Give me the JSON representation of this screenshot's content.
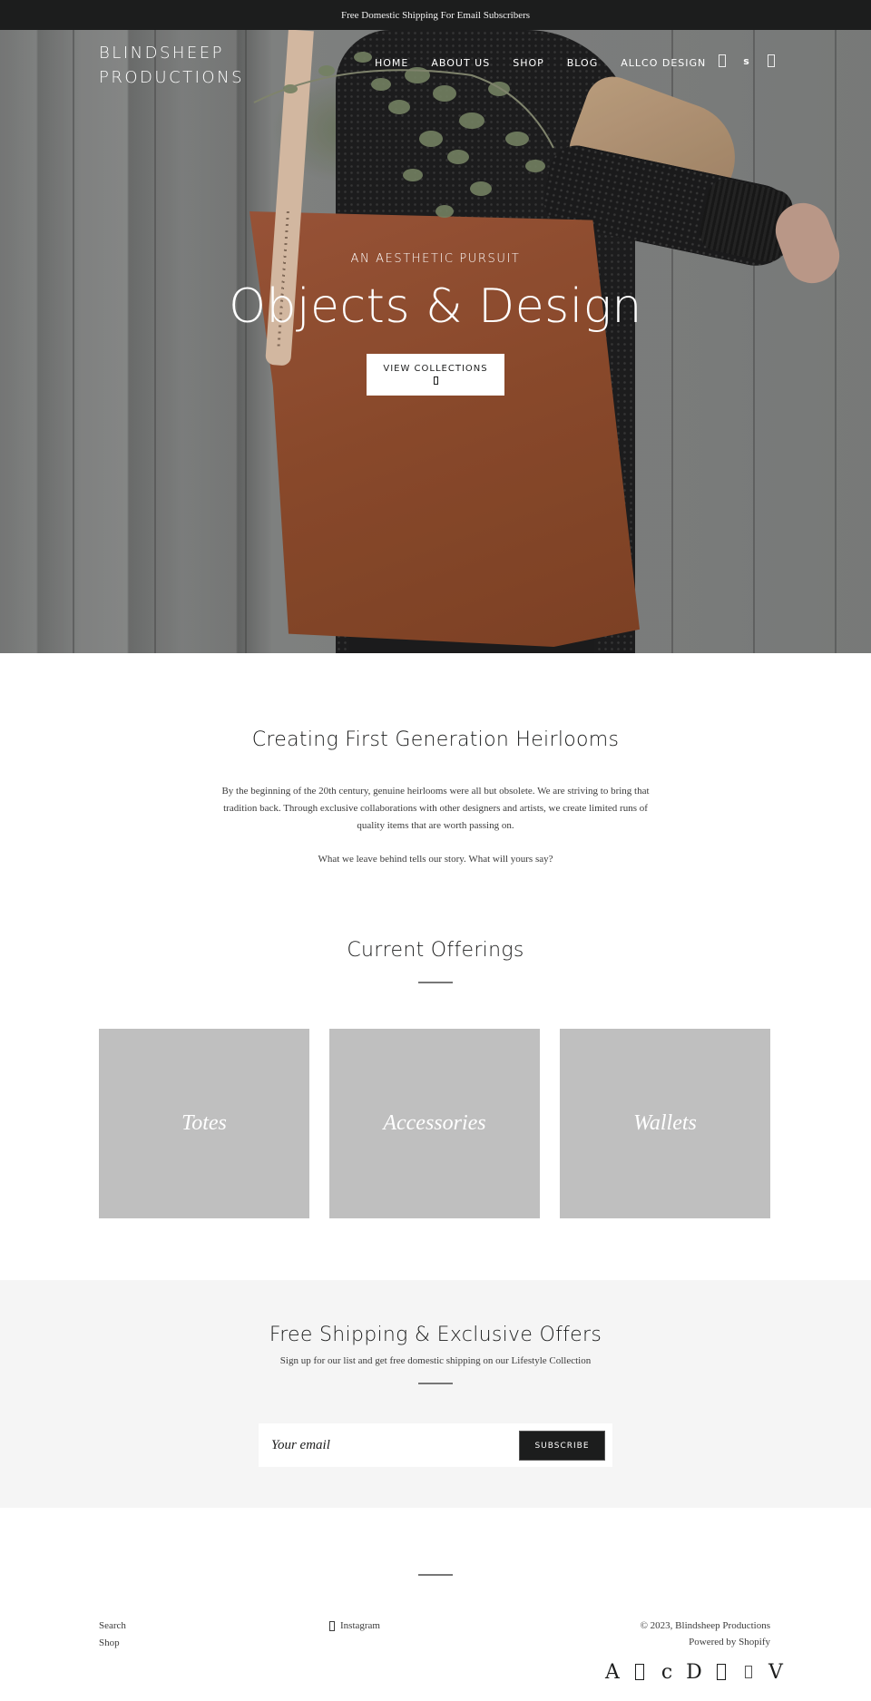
{
  "announcement": {
    "text": "Free Domestic Shipping For Email Subscribers"
  },
  "header": {
    "logo_line1": "BLINDSHEEP",
    "logo_line2": "PRODUCTIONS",
    "nav": [
      {
        "label": "HOME"
      },
      {
        "label": "ABOUT US"
      },
      {
        "label": "SHOP"
      },
      {
        "label": "BLOG"
      },
      {
        "label": "ALLCO DESIGN"
      }
    ],
    "icons": {
      "search": "search-icon",
      "account_glyph": "s",
      "account": "account-icon",
      "cart": "cart-icon"
    }
  },
  "hero": {
    "subtitle": "AN AESTHETIC PURSUIT",
    "title": "Objects & Design",
    "button_label": "VIEW COLLECTIONS",
    "button_icon": "arrow-right-icon"
  },
  "intro": {
    "title": "Creating First Generation Heirlooms",
    "paragraph1": "By the beginning of the 20th century, genuine heirlooms were all but obsolete. We are striving to bring that tradition back. Through exclusive collaborations with other designers and artists, we create limited runs of quality items that are worth passing on.",
    "paragraph2": "What we leave behind tells our story. What will yours say?"
  },
  "offerings": {
    "title": "Current Offerings",
    "collections": [
      {
        "label": "Totes"
      },
      {
        "label": "Accessories"
      },
      {
        "label": "Wallets"
      }
    ]
  },
  "newsletter": {
    "title": "Free Shipping & Exclusive Offers",
    "subtitle": "Sign up for our list and get free domestic shipping on our Lifestyle Collection",
    "email_placeholder": "Your email",
    "email_value": "",
    "button_label": "SUBSCRIBE"
  },
  "footer": {
    "links": [
      {
        "label": "Search"
      },
      {
        "label": "Shop"
      }
    ],
    "social": {
      "icon": "instagram-icon",
      "label": "Instagram"
    },
    "copyright": "© 2023, Blindsheep Productions",
    "powered_by": "Powered by Shopify",
    "payment_icons": [
      {
        "name": "american-express-icon",
        "glyph": "A"
      },
      {
        "name": "apple-pay-icon",
        "glyph": ""
      },
      {
        "name": "diners-club-icon",
        "glyph": "c"
      },
      {
        "name": "discover-icon",
        "glyph": "D"
      },
      {
        "name": "google-pay-icon",
        "glyph": ""
      },
      {
        "name": "mastercard-icon",
        "glyph": ""
      },
      {
        "name": "visa-icon",
        "glyph": "V"
      }
    ]
  },
  "colors": {
    "dark": "#1c1d1d",
    "light_section": "#f5f5f5",
    "card_placeholder": "#bfbfbf",
    "white": "#ffffff"
  }
}
